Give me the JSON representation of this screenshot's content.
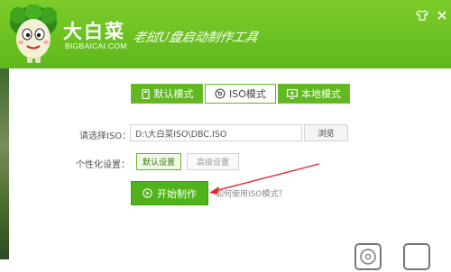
{
  "header": {
    "brand_name": "大白菜",
    "brand_domain": "BIGBAICAI.COM",
    "slogan": "老挝U盘启动制作工具",
    "colors": {
      "header_green": "#5fb81c",
      "accent_green": "#62b822"
    }
  },
  "window": {
    "min_icon": "shirt-skin-icon",
    "close_icon": "close-icon"
  },
  "tabs": [
    {
      "label": "默认模式",
      "icon": "usb-icon",
      "active": false
    },
    {
      "label": "ISO模式",
      "icon": "disc-icon",
      "active": true
    },
    {
      "label": "本地模式",
      "icon": "monitor-icon",
      "active": false
    }
  ],
  "iso": {
    "label": "请选择ISO：",
    "path": "D:\\大白菜ISO\\DBC.ISO",
    "browse": "浏览"
  },
  "personalize": {
    "label": "个性化设置：",
    "default_btn": "默认设置",
    "advanced_btn": "高级设置"
  },
  "start": {
    "label": "开始制作",
    "icon": "play-circle-icon"
  },
  "help_link": "如何使用ISO模式？",
  "bottom": {
    "left_icon": "disc-icon",
    "right_icon": "box-icon"
  }
}
